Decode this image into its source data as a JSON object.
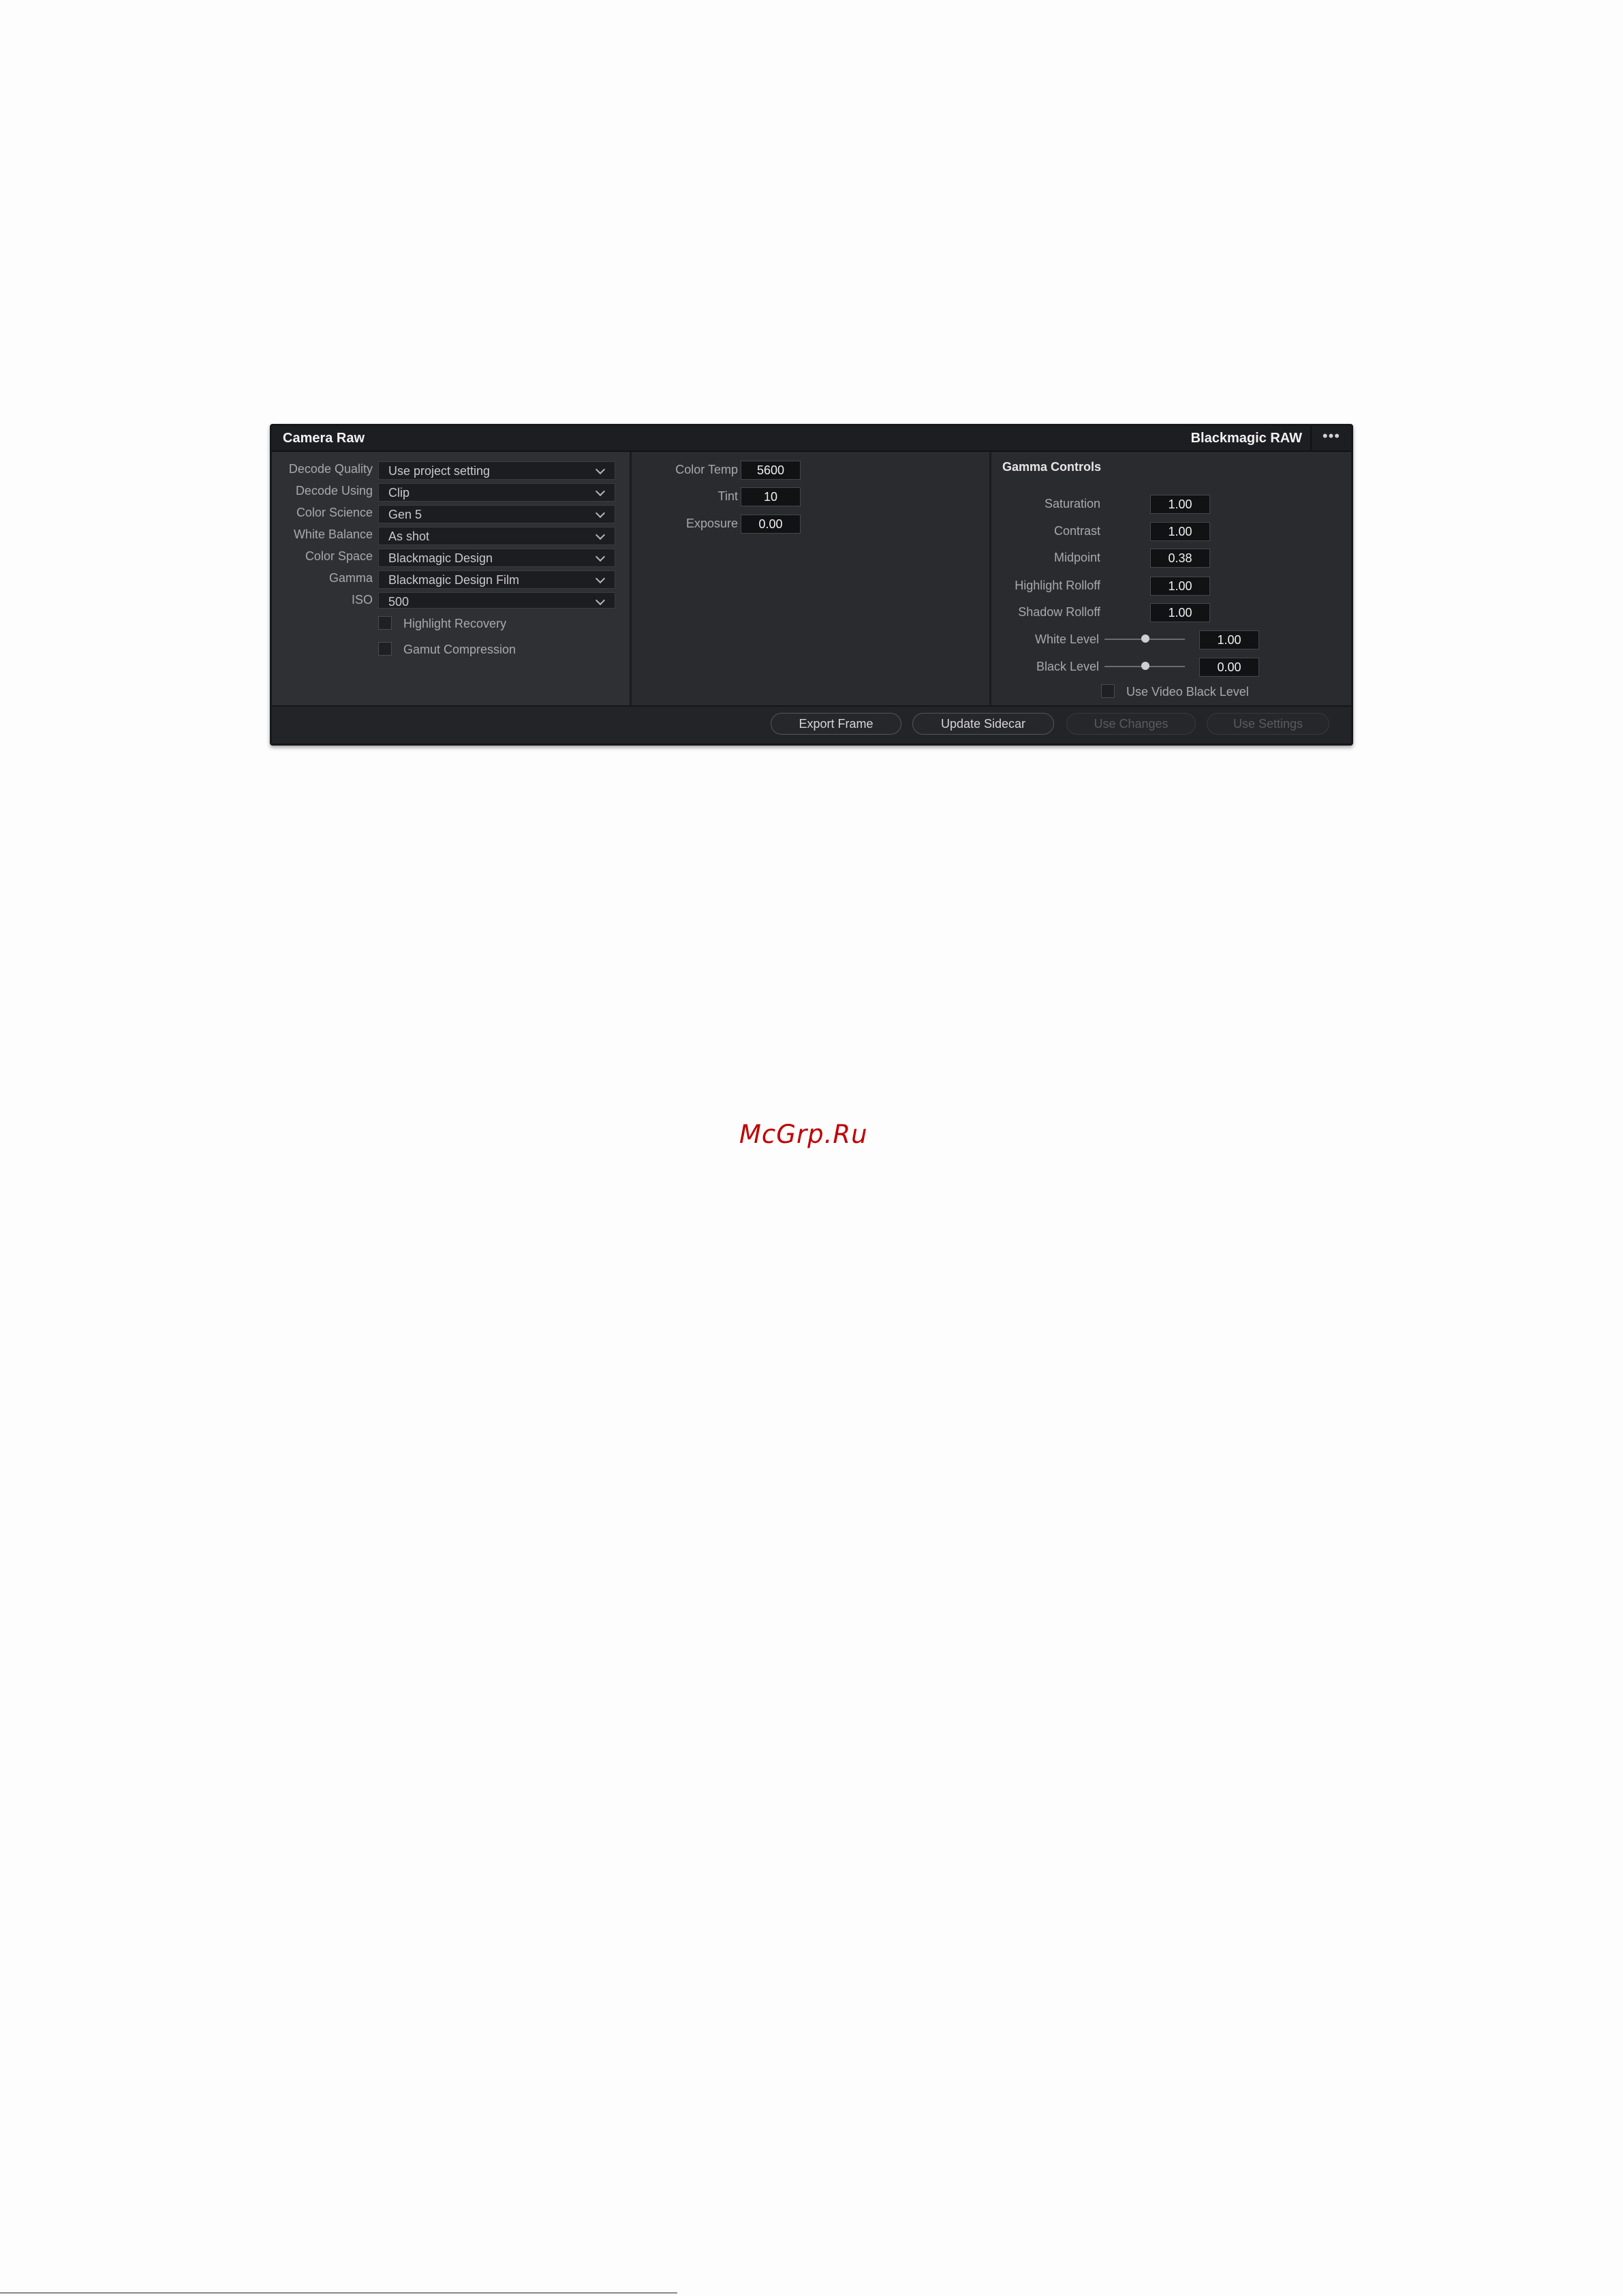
{
  "panel": {
    "title": "Camera Raw",
    "brand": "Blackmagic RAW",
    "menu": "•••"
  },
  "decode": {
    "fields": [
      {
        "label": "Decode Quality",
        "value": "Use project setting"
      },
      {
        "label": "Decode Using",
        "value": "Clip"
      },
      {
        "label": "Color Science",
        "value": "Gen 5"
      },
      {
        "label": "White Balance",
        "value": "As shot"
      },
      {
        "label": "Color Space",
        "value": "Blackmagic Design"
      },
      {
        "label": "Gamma",
        "value": "Blackmagic Design Film"
      },
      {
        "label": "ISO",
        "value": "500"
      }
    ],
    "checkboxes": [
      {
        "label": "Highlight Recovery",
        "checked": false
      },
      {
        "label": "Gamut Compression",
        "checked": false
      }
    ]
  },
  "color": {
    "fields": [
      {
        "label": "Color Temp",
        "value": "5600"
      },
      {
        "label": "Tint",
        "value": "10"
      },
      {
        "label": "Exposure",
        "value": "0.00"
      }
    ]
  },
  "gamma": {
    "title": "Gamma Controls",
    "fields": [
      {
        "label": "Saturation",
        "value": "1.00"
      },
      {
        "label": "Contrast",
        "value": "1.00"
      },
      {
        "label": "Midpoint",
        "value": "0.38"
      },
      {
        "label": "Highlight Rolloff",
        "value": "1.00"
      },
      {
        "label": "Shadow Rolloff",
        "value": "1.00"
      }
    ],
    "sliders": [
      {
        "label": "White Level",
        "value": "1.00"
      },
      {
        "label": "Black Level",
        "value": "0.00"
      }
    ],
    "checkbox": {
      "label": "Use Video Black Level",
      "checked": false
    }
  },
  "footer": {
    "buttons": [
      {
        "label": "Export Frame",
        "enabled": true
      },
      {
        "label": "Update Sidecar",
        "enabled": true
      },
      {
        "label": "Use Changes",
        "enabled": false
      },
      {
        "label": "Use Settings",
        "enabled": false
      }
    ]
  },
  "watermark": "McGrp.Ru",
  "colors": {
    "panel_bg": "#2b2c2f",
    "field_bg": "#1c1d20",
    "watermark": "#c00000"
  }
}
